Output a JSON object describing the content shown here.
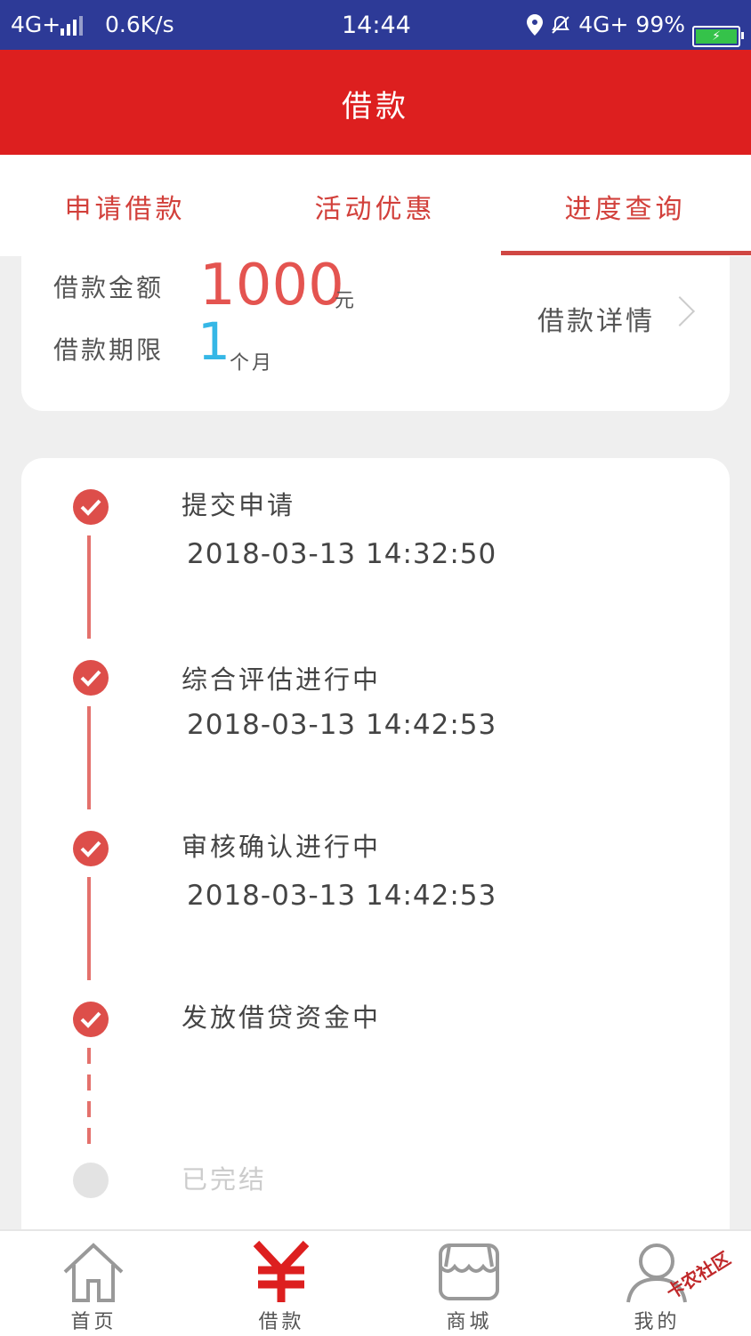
{
  "status_bar": {
    "network": "4G+",
    "speed": "0.6K/s",
    "time": "14:44",
    "right_network": "4G+",
    "battery": "99%"
  },
  "header": {
    "title": "借款"
  },
  "tabs": [
    {
      "label": "申请借款"
    },
    {
      "label": "活动优惠"
    },
    {
      "label": "进度查询",
      "active": true
    }
  ],
  "loan": {
    "amount_label": "借款金额",
    "amount": "1000",
    "amount_unit": "元",
    "term_label": "借款期限",
    "term": "1",
    "term_unit": "个月",
    "detail_link": "借款详情"
  },
  "progress": [
    {
      "title": "提交申请",
      "time": "2018-03-13 14:32:50",
      "done": true
    },
    {
      "title": "综合评估进行中",
      "time": "2018-03-13 14:42:53",
      "done": true
    },
    {
      "title": "审核确认进行中",
      "time": "2018-03-13 14:42:53",
      "done": true
    },
    {
      "title": "发放借贷资金中",
      "time": "",
      "done": true
    },
    {
      "title": "已完结",
      "time": "",
      "done": false
    }
  ],
  "bottom_nav": [
    {
      "label": "首页",
      "icon": "home-icon"
    },
    {
      "label": "借款",
      "icon": "yen-icon",
      "active": true
    },
    {
      "label": "商城",
      "icon": "shop-icon"
    },
    {
      "label": "我的",
      "icon": "user-icon"
    }
  ],
  "watermark": "卡农社区",
  "colors": {
    "status_bar": "#2d3a97",
    "header": "#dd1f1f",
    "accent": "#d04743",
    "term": "#35b7e6"
  }
}
